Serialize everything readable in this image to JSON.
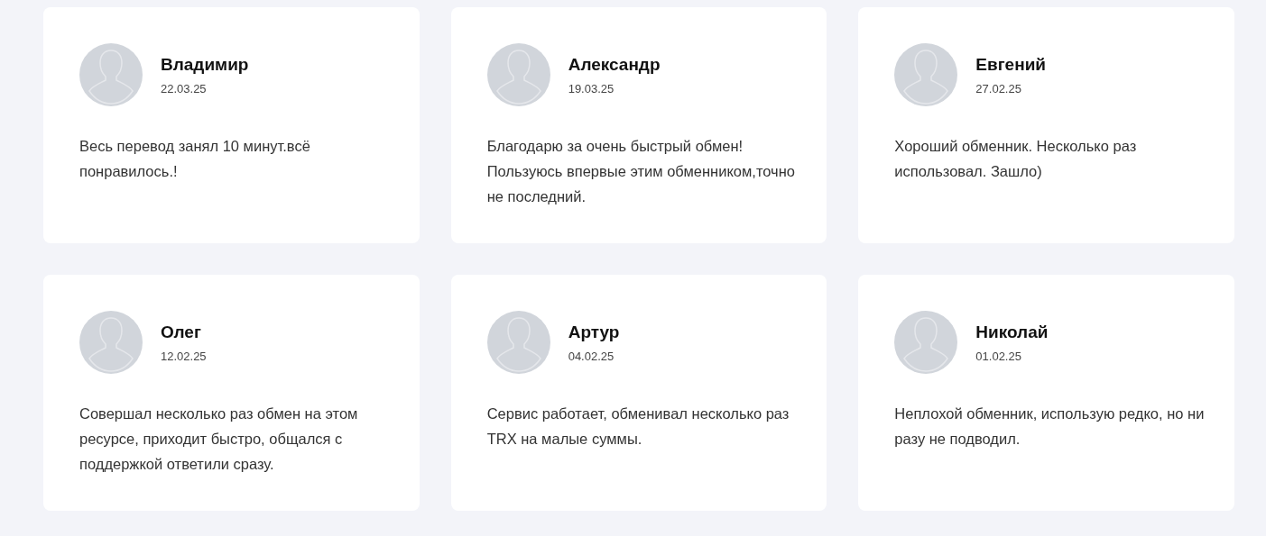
{
  "reviews": [
    {
      "name": "Владимир",
      "date": "22.03.25",
      "text": "Весь перевод занял 10 минут.всё понравилось.!"
    },
    {
      "name": "Александр",
      "date": "19.03.25",
      "text": "Благодарю за очень быстрый обмен! Пользуюсь впервые этим обменником,точно не последний."
    },
    {
      "name": "Евгений",
      "date": "27.02.25",
      "text": "Хороший обменник. Несколько раз использовал. Зашло)"
    },
    {
      "name": "Олег",
      "date": "12.02.25",
      "text": "Совершал несколько раз обмен на этом ресурсе, приходит быстро, общался с поддержкой ответили сразу."
    },
    {
      "name": "Артур",
      "date": "04.02.25",
      "text": "Сервис работает, обменивал несколько раз TRX на малые суммы."
    },
    {
      "name": "Николай",
      "date": "01.02.25",
      "text": "Неплохой обменник, использую редко, но ни разу не подводил."
    }
  ]
}
